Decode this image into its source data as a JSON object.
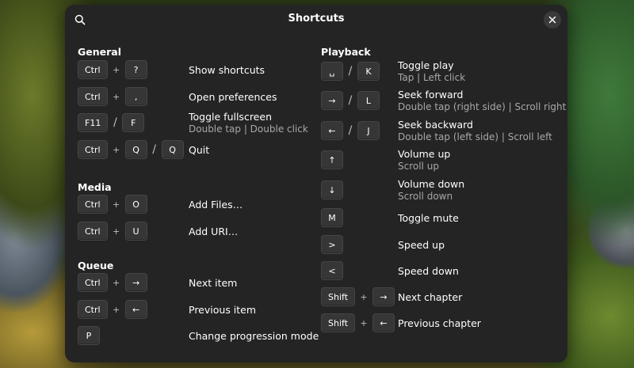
{
  "dialog": {
    "title": "Shortcuts"
  },
  "icons": {
    "search": "search-icon",
    "close": "close-icon"
  },
  "sections": {
    "general": {
      "title": "General",
      "items": [
        {
          "keys": [
            "Ctrl",
            "+",
            "?"
          ],
          "label": "Show shortcuts",
          "sub": ""
        },
        {
          "keys": [
            "Ctrl",
            "+",
            ","
          ],
          "label": "Open preferences",
          "sub": ""
        },
        {
          "keys": [
            "F11",
            "/",
            "F"
          ],
          "label": "Toggle fullscreen",
          "sub": "Double tap | Double click"
        },
        {
          "keys": [
            "Ctrl",
            "+",
            "Q",
            "/",
            "Q"
          ],
          "label": "Quit",
          "sub": ""
        }
      ]
    },
    "media": {
      "title": "Media",
      "items": [
        {
          "keys": [
            "Ctrl",
            "+",
            "O"
          ],
          "label": "Add Files…",
          "sub": ""
        },
        {
          "keys": [
            "Ctrl",
            "+",
            "U"
          ],
          "label": "Add URI…",
          "sub": ""
        }
      ]
    },
    "queue": {
      "title": "Queue",
      "items": [
        {
          "keys": [
            "Ctrl",
            "+",
            "→"
          ],
          "label": "Next item",
          "sub": ""
        },
        {
          "keys": [
            "Ctrl",
            "+",
            "←"
          ],
          "label": "Previous item",
          "sub": ""
        },
        {
          "keys": [
            "P"
          ],
          "label": "Change progression mode",
          "sub": ""
        }
      ]
    },
    "playback": {
      "title": "Playback",
      "items": [
        {
          "keys": [
            "␣",
            "/",
            "K"
          ],
          "label": "Toggle play",
          "sub": "Tap | Left click"
        },
        {
          "keys": [
            "→",
            "/",
            "L"
          ],
          "label": "Seek forward",
          "sub": "Double tap (right side) | Scroll right"
        },
        {
          "keys": [
            "←",
            "/",
            "J"
          ],
          "label": "Seek backward",
          "sub": "Double tap (left side) | Scroll left"
        },
        {
          "keys": [
            "↑"
          ],
          "label": "Volume up",
          "sub": "Scroll up"
        },
        {
          "keys": [
            "↓"
          ],
          "label": "Volume down",
          "sub": "Scroll down"
        },
        {
          "keys": [
            "M"
          ],
          "label": "Toggle mute",
          "sub": ""
        },
        {
          "keys": [
            ">"
          ],
          "label": "Speed up",
          "sub": ""
        },
        {
          "keys": [
            "<"
          ],
          "label": "Speed down",
          "sub": ""
        },
        {
          "keys": [
            "Shift",
            "+",
            "→"
          ],
          "label": "Next chapter",
          "sub": ""
        },
        {
          "keys": [
            "Shift",
            "+",
            "←"
          ],
          "label": "Previous chapter",
          "sub": ""
        }
      ]
    }
  }
}
